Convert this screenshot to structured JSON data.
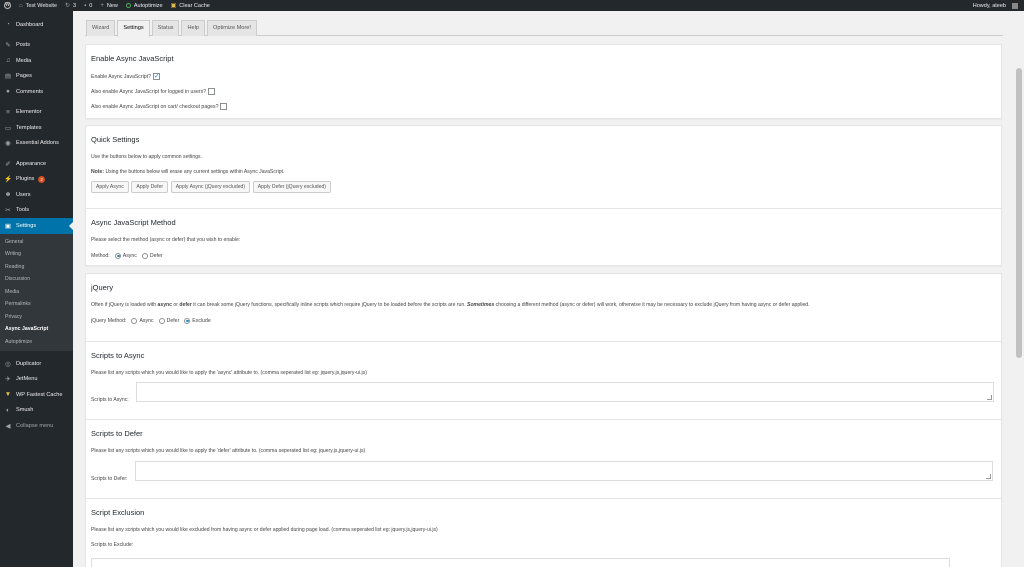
{
  "adminbar": {
    "site_name": "Test Website",
    "updates_count": "3",
    "comments_count": "0",
    "new_label": "New",
    "autoptimize_label": "Autoptimize",
    "clear_cache_label": "Clear Cache",
    "howdy": "Howdy, ateeb"
  },
  "sidebar": {
    "dashboard": "Dashboard",
    "posts": "Posts",
    "media": "Media",
    "pages": "Pages",
    "comments": "Comments",
    "elementor": "Elementor",
    "templates": "Templates",
    "essential_addons": "Essential Addons",
    "appearance": "Appearance",
    "plugins": "Plugins",
    "plugins_badge": "2",
    "users": "Users",
    "tools": "Tools",
    "settings": "Settings",
    "submenu": [
      "General",
      "Writing",
      "Reading",
      "Discussion",
      "Media",
      "Permalinks",
      "Privacy",
      "Async JavaScript",
      "Autoptimize"
    ],
    "duplicator": "Duplicator",
    "jetmenu": "JetMenu",
    "wp_fastest_cache": "WP Fastest Cache",
    "smush": "Smush",
    "collapse": "Collapse menu"
  },
  "tabs": [
    "Wizard",
    "Settings",
    "Status",
    "Help",
    "Optimize More!"
  ],
  "enable": {
    "title": "Enable Async JavaScript",
    "enable_label": "Enable Async JavaScript?",
    "logged_in_label": "Also enable Async JavaScript for logged in users?",
    "cart_label": "Also enable Async JavaScript on cart/ checkout pages?"
  },
  "quick": {
    "title": "Quick Settings",
    "desc": "Use the buttons below to apply common settings.",
    "note_bold": "Note:",
    "note_text": "Using the buttons below will erase any current settings within Async JavaScript.",
    "buttons": [
      "Apply Async",
      "Apply Defer",
      "Apply Async (jQuery excluded)",
      "Apply Defer (jQuery excluded)"
    ]
  },
  "method": {
    "title": "Async JavaScript Method",
    "desc": "Please select the method (async or defer) that you wish to enable:",
    "label": "Method:",
    "async": "Async",
    "defer": "Defer"
  },
  "jquery": {
    "title": "jQuery",
    "desc_1": "Often if jQuery is loaded with ",
    "desc_async": "async",
    "desc_2": " or ",
    "desc_defer": "defer",
    "desc_3": " it can break some jQuery functions, specifically inline scripts which require jQuery to be loaded before the scripts are run. ",
    "desc_sometimes": "Sometimes",
    "desc_4": " choosing a different method (async or defer) will work, otherwise it may be necessary to exclude jQuery from having async or defer applied.",
    "label": "jQuery Method:",
    "async": "Async",
    "defer": "Defer",
    "exclude": "Exclude"
  },
  "scripts_async": {
    "title": "Scripts to Async",
    "desc": "Please list any scripts which you would like to apply the 'async' attribute to. (comma seperated list eg: jquery.js,jquery-ui.js)",
    "label": "Scripts to Async:"
  },
  "scripts_defer": {
    "title": "Scripts to Defer",
    "desc": "Please list any scripts which you would like to apply the 'defer' attribute to. (comma seperated list eg: jquery.js,jquery-ui.js)",
    "label": "Scripts to Defer:"
  },
  "exclusion": {
    "title": "Script Exclusion",
    "desc": "Please list any scripts which you would like excluded from having async or defer applied during page load. (comma seperated list eg: jquery.js,jquery-ui.js)",
    "label": "Scripts to Exclude:"
  }
}
